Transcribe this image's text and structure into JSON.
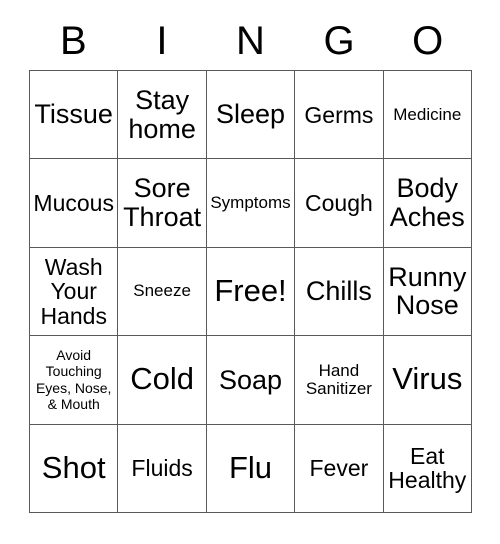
{
  "card": {
    "title": "Bingo Card",
    "background_color": "#ffffff",
    "border_color": "#595959",
    "text_color": "#000000"
  },
  "header": {
    "letters": [
      {
        "label": "B"
      },
      {
        "label": "I"
      },
      {
        "label": "N"
      },
      {
        "label": "G"
      },
      {
        "label": "O"
      }
    ]
  },
  "grid": {
    "rows": 5,
    "columns": 5,
    "free_space": {
      "row": 2,
      "column": 2,
      "label": "Free!"
    },
    "cells": [
      [
        {
          "label": "Tissue",
          "size": "lg"
        },
        {
          "label": "Stay\nhome",
          "size": "lg"
        },
        {
          "label": "Sleep",
          "size": "lg"
        },
        {
          "label": "Germs",
          "size": "md"
        },
        {
          "label": "Medicine",
          "size": "sm"
        }
      ],
      [
        {
          "label": "Mucous",
          "size": "md"
        },
        {
          "label": "Sore\nThroat",
          "size": "lg"
        },
        {
          "label": "Symptoms",
          "size": "sm"
        },
        {
          "label": "Cough",
          "size": "md"
        },
        {
          "label": "Body\nAches",
          "size": "lg"
        }
      ],
      [
        {
          "label": "Wash\nYour\nHands",
          "size": "md"
        },
        {
          "label": "Sneeze",
          "size": "sm"
        },
        {
          "label": "Free!",
          "size": "xl"
        },
        {
          "label": "Chills",
          "size": "lg"
        },
        {
          "label": "Runny\nNose",
          "size": "lg"
        }
      ],
      [
        {
          "label": "Avoid\nTouching\nEyes, Nose,\n& Mouth",
          "size": "xs"
        },
        {
          "label": "Cold",
          "size": "xl"
        },
        {
          "label": "Soap",
          "size": "lg"
        },
        {
          "label": "Hand\nSanitizer",
          "size": "sm"
        },
        {
          "label": "Virus",
          "size": "xl"
        }
      ],
      [
        {
          "label": "Shot",
          "size": "xl"
        },
        {
          "label": "Fluids",
          "size": "md"
        },
        {
          "label": "Flu",
          "size": "xl"
        },
        {
          "label": "Fever",
          "size": "md"
        },
        {
          "label": "Eat\nHealthy",
          "size": "md"
        }
      ]
    ]
  }
}
